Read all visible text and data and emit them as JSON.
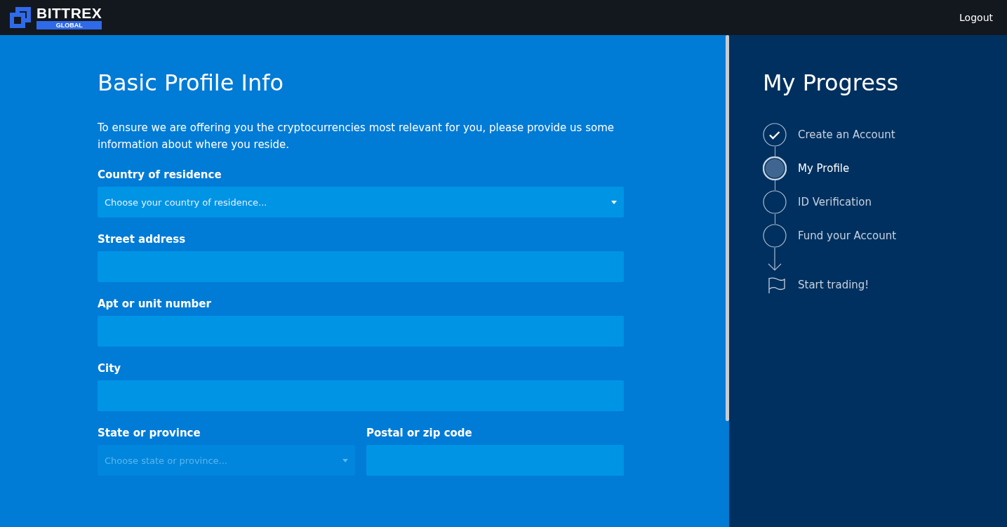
{
  "header": {
    "logo": {
      "name": "BITTREX",
      "badge": "GLOBAL"
    },
    "logout": "Logout"
  },
  "form": {
    "title": "Basic Profile Info",
    "intro": "To ensure we are offering you the cryptocurrencies most relevant for you, please provide us some information about where you reside.",
    "rows": [
      {
        "fields": [
          {
            "label": "Country of residence",
            "kind": "select",
            "placeholder": "Choose your country of residence...",
            "disabled": false
          }
        ]
      },
      {
        "fields": [
          {
            "label": "Street address",
            "kind": "text",
            "disabled": false
          }
        ]
      },
      {
        "fields": [
          {
            "label": "Apt or unit number",
            "kind": "text",
            "disabled": false
          }
        ]
      },
      {
        "fields": [
          {
            "label": "City",
            "kind": "text",
            "disabled": false
          }
        ]
      },
      {
        "fields": [
          {
            "label": "State or province",
            "kind": "select",
            "placeholder": "Choose state or province...",
            "disabled": true
          },
          {
            "label": "Postal or zip code",
            "kind": "text",
            "disabled": false
          }
        ]
      }
    ]
  },
  "progress": {
    "title": "My Progress",
    "steps": [
      {
        "label": "Create an Account",
        "completed": true,
        "selected": false
      },
      {
        "label": "My Profile",
        "completed": false,
        "selected": true
      },
      {
        "label": "ID Verification",
        "completed": false,
        "selected": false
      },
      {
        "label": "Fund your Account",
        "completed": false,
        "selected": false
      }
    ],
    "finish": "Start trading!"
  }
}
